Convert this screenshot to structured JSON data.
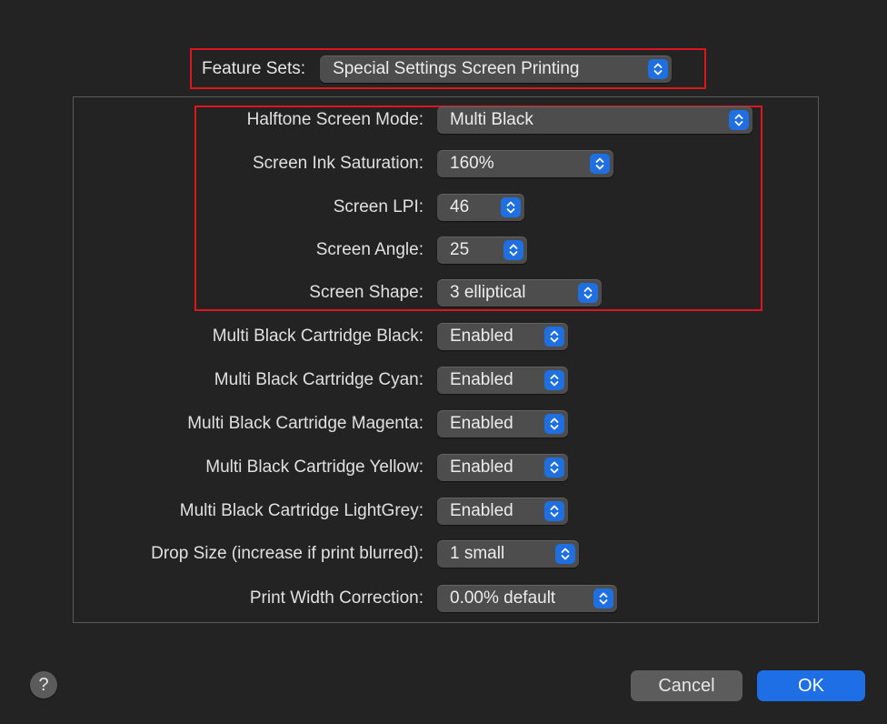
{
  "feature_sets": {
    "label": "Feature Sets:",
    "value": "Special Settings Screen Printing"
  },
  "settings": [
    {
      "label": "Halftone Screen Mode:",
      "value": "Multi Black"
    },
    {
      "label": "Screen Ink Saturation:",
      "value": "160%"
    },
    {
      "label": "Screen LPI:",
      "value": "46"
    },
    {
      "label": "Screen Angle:",
      "value": "25"
    },
    {
      "label": "Screen Shape:",
      "value": "3 elliptical"
    },
    {
      "label": "Multi Black Cartridge Black:",
      "value": "Enabled"
    },
    {
      "label": "Multi Black Cartridge Cyan:",
      "value": "Enabled"
    },
    {
      "label": "Multi Black Cartridge Magenta:",
      "value": "Enabled"
    },
    {
      "label": "Multi Black Cartridge Yellow:",
      "value": "Enabled"
    },
    {
      "label": "Multi Black Cartridge LightGrey:",
      "value": "Enabled"
    },
    {
      "label": "Drop Size (increase if print blurred):",
      "value": "1 small"
    },
    {
      "label": "Print Width Correction:",
      "value": "0.00% default"
    }
  ],
  "buttons": {
    "help": "?",
    "cancel": "Cancel",
    "ok": "OK"
  },
  "colors": {
    "background": "#232323",
    "accent": "#1e6fe6",
    "highlight": "#e0151b"
  }
}
